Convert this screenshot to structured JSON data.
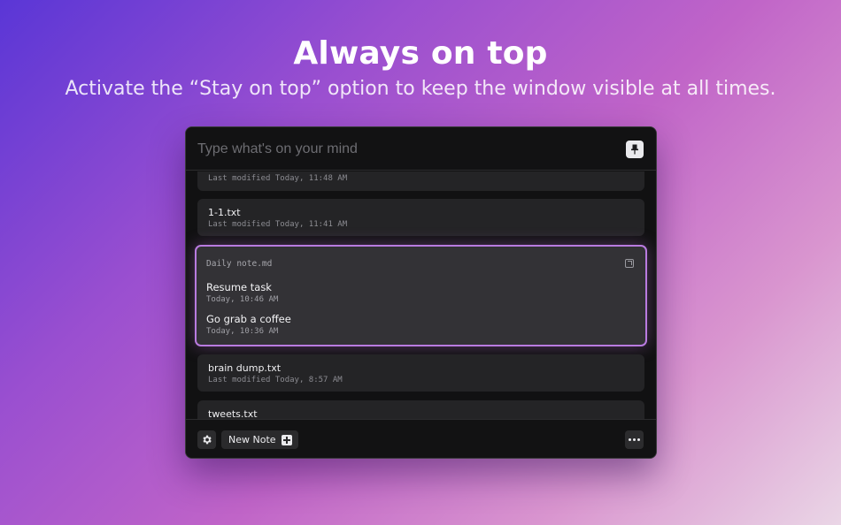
{
  "hero": {
    "title": "Always on top",
    "subtitle": "Activate the “Stay on top” option to keep the window visible at all times."
  },
  "window": {
    "search": {
      "placeholder": "Type what's on your mind",
      "value": ""
    },
    "pin_icon": "pin-icon",
    "notes": [
      {
        "name": "",
        "meta": "Last modified Today, 11:48 AM"
      },
      {
        "name": "1-1.txt",
        "meta": "Last modified Today, 11:41 AM"
      },
      {
        "name": "brain dump.txt",
        "meta": "Last modified Today, 8:57 AM"
      },
      {
        "name": "tweets.txt",
        "meta": ""
      }
    ],
    "active_note": {
      "file": "Daily note.md",
      "open_icon": "open-external-icon",
      "entries": [
        {
          "title": "Resume task",
          "time": "Today, 10:46 AM"
        },
        {
          "title": "Go grab a coffee",
          "time": "Today, 10:36 AM"
        }
      ]
    },
    "footer": {
      "settings_icon": "gear-icon",
      "new_note_label": "New Note",
      "new_note_icon": "plus-icon",
      "more_icon": "more-icon"
    }
  },
  "colors": {
    "accent": "#b97be0",
    "window_bg": "#111112",
    "card_bg": "#242426"
  }
}
